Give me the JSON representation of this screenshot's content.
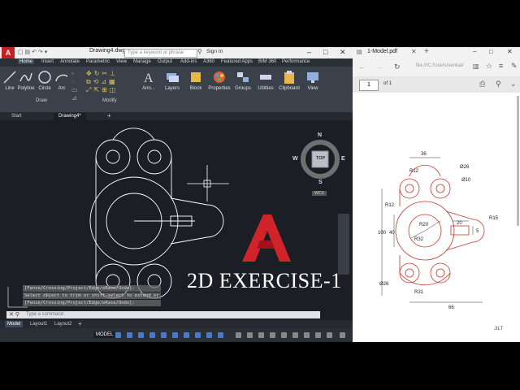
{
  "acad": {
    "doc_title": "Drawing4.dwg",
    "search_placeholder": "Type a keyword or phrase",
    "signin": "Sign In",
    "ribbon_tabs": [
      "Home",
      "Insert",
      "Annotate",
      "Parametric",
      "View",
      "Manage",
      "Output",
      "Add-ins",
      "A360",
      "Featured Apps",
      "BIM 360",
      "Performance"
    ],
    "tools": {
      "line": "Line",
      "polyline": "Polyline",
      "circle": "Circle",
      "arc": "Arc",
      "annotation": "Ann...",
      "layers": "Layers",
      "block": "Block",
      "properties": "Properties",
      "groups": "Groups",
      "utilities": "Utilities",
      "clipboard": "Clipboard",
      "view": "View"
    },
    "groups": {
      "draw": "Draw",
      "modify": "Modify"
    },
    "file_tabs": {
      "start": "Start",
      "drawing": "Drawing4*"
    },
    "viewcube": {
      "n": "N",
      "s": "S",
      "e": "E",
      "w": "W",
      "top": "TOP",
      "wcs": "WCS"
    },
    "cmd_history": [
      "[Fence/Crossing/Project/Edge/eRase/Undo]:",
      "Select object to trim or shift-select to extend or",
      "[Fence/Crossing/Project/Edge/eRase/Undo]:"
    ],
    "cmd_placeholder": "Type a command",
    "layout_tabs": [
      "Model",
      "Layout1",
      "Layout2"
    ],
    "model_button": "MODEL"
  },
  "pdf": {
    "tab_title": "1-Model.pdf",
    "url": "file:///C:/Users/venkat/",
    "page": "1",
    "page_of": "of 1",
    "dims": {
      "d36": "36",
      "r12a": "R12",
      "r12b": "R12",
      "o26a": "Ø26",
      "o10": "Ø10",
      "r20": "R20",
      "d20": "20",
      "r15": "R15",
      "d100": "100",
      "d40": "40",
      "r32": "R32",
      "o26b": "Ø26",
      "r31": "R31",
      "d66": "66",
      "d5": "5"
    },
    "watermark": "JILT"
  },
  "overlay": {
    "exercise_title": "2D EXERCISE-1"
  }
}
